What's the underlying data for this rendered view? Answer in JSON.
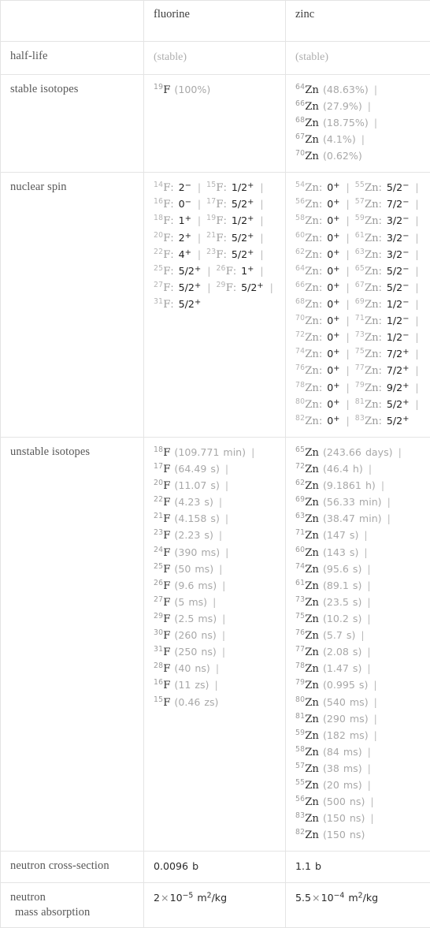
{
  "table": {
    "columns": [
      "",
      "fluorine",
      "zinc"
    ],
    "rows": [
      {
        "label": "half-life",
        "fluorine": "(stable)",
        "zinc": "(stable)"
      },
      {
        "label": "stable isotopes",
        "fluorine_items": [
          {
            "mass": "19",
            "element": "F",
            "value": "(100%)"
          }
        ],
        "zinc_items": [
          {
            "mass": "64",
            "element": "Zn",
            "value": "(48.63%)"
          },
          {
            "mass": "66",
            "element": "Zn",
            "value": "(27.9%)"
          },
          {
            "mass": "68",
            "element": "Zn",
            "value": "(18.75%)"
          },
          {
            "mass": "67",
            "element": "Zn",
            "value": "(4.1%)"
          },
          {
            "mass": "70",
            "element": "Zn",
            "value": "(0.62%)"
          }
        ]
      },
      {
        "label": "nuclear spin",
        "fluorine_items": [
          {
            "mass": "14",
            "element": "F",
            "spin": "2",
            "sign": "-"
          },
          {
            "mass": "15",
            "element": "F",
            "spin": "1/2",
            "sign": "+"
          },
          {
            "mass": "16",
            "element": "F",
            "spin": "0",
            "sign": "-"
          },
          {
            "mass": "17",
            "element": "F",
            "spin": "5/2",
            "sign": "+"
          },
          {
            "mass": "18",
            "element": "F",
            "spin": "1",
            "sign": "+"
          },
          {
            "mass": "19",
            "element": "F",
            "spin": "1/2",
            "sign": "+"
          },
          {
            "mass": "20",
            "element": "F",
            "spin": "2",
            "sign": "+"
          },
          {
            "mass": "21",
            "element": "F",
            "spin": "5/2",
            "sign": "+"
          },
          {
            "mass": "22",
            "element": "F",
            "spin": "4",
            "sign": "+"
          },
          {
            "mass": "23",
            "element": "F",
            "spin": "5/2",
            "sign": "+"
          },
          {
            "mass": "25",
            "element": "F",
            "spin": "5/2",
            "sign": "+"
          },
          {
            "mass": "26",
            "element": "F",
            "spin": "1",
            "sign": "+"
          },
          {
            "mass": "27",
            "element": "F",
            "spin": "5/2",
            "sign": "+"
          },
          {
            "mass": "29",
            "element": "F",
            "spin": "5/2",
            "sign": "+"
          },
          {
            "mass": "31",
            "element": "F",
            "spin": "5/2",
            "sign": "+"
          }
        ],
        "zinc_items": [
          {
            "mass": "54",
            "element": "Zn",
            "spin": "0",
            "sign": "+"
          },
          {
            "mass": "55",
            "element": "Zn",
            "spin": "5/2",
            "sign": "-"
          },
          {
            "mass": "56",
            "element": "Zn",
            "spin": "0",
            "sign": "+"
          },
          {
            "mass": "57",
            "element": "Zn",
            "spin": "7/2",
            "sign": "-"
          },
          {
            "mass": "58",
            "element": "Zn",
            "spin": "0",
            "sign": "+"
          },
          {
            "mass": "59",
            "element": "Zn",
            "spin": "3/2",
            "sign": "-"
          },
          {
            "mass": "60",
            "element": "Zn",
            "spin": "0",
            "sign": "+"
          },
          {
            "mass": "61",
            "element": "Zn",
            "spin": "3/2",
            "sign": "-"
          },
          {
            "mass": "62",
            "element": "Zn",
            "spin": "0",
            "sign": "+"
          },
          {
            "mass": "63",
            "element": "Zn",
            "spin": "3/2",
            "sign": "-"
          },
          {
            "mass": "64",
            "element": "Zn",
            "spin": "0",
            "sign": "+"
          },
          {
            "mass": "65",
            "element": "Zn",
            "spin": "5/2",
            "sign": "-"
          },
          {
            "mass": "66",
            "element": "Zn",
            "spin": "0",
            "sign": "+"
          },
          {
            "mass": "67",
            "element": "Zn",
            "spin": "5/2",
            "sign": "-"
          },
          {
            "mass": "68",
            "element": "Zn",
            "spin": "0",
            "sign": "+"
          },
          {
            "mass": "69",
            "element": "Zn",
            "spin": "1/2",
            "sign": "-"
          },
          {
            "mass": "70",
            "element": "Zn",
            "spin": "0",
            "sign": "+"
          },
          {
            "mass": "71",
            "element": "Zn",
            "spin": "1/2",
            "sign": "-"
          },
          {
            "mass": "72",
            "element": "Zn",
            "spin": "0",
            "sign": "+"
          },
          {
            "mass": "73",
            "element": "Zn",
            "spin": "1/2",
            "sign": "-"
          },
          {
            "mass": "74",
            "element": "Zn",
            "spin": "0",
            "sign": "+"
          },
          {
            "mass": "75",
            "element": "Zn",
            "spin": "7/2",
            "sign": "+"
          },
          {
            "mass": "76",
            "element": "Zn",
            "spin": "0",
            "sign": "+"
          },
          {
            "mass": "77",
            "element": "Zn",
            "spin": "7/2",
            "sign": "+"
          },
          {
            "mass": "78",
            "element": "Zn",
            "spin": "0",
            "sign": "+"
          },
          {
            "mass": "79",
            "element": "Zn",
            "spin": "9/2",
            "sign": "+"
          },
          {
            "mass": "80",
            "element": "Zn",
            "spin": "0",
            "sign": "+"
          },
          {
            "mass": "81",
            "element": "Zn",
            "spin": "5/2",
            "sign": "+"
          },
          {
            "mass": "82",
            "element": "Zn",
            "spin": "0",
            "sign": "+"
          },
          {
            "mass": "83",
            "element": "Zn",
            "spin": "5/2",
            "sign": "+"
          }
        ]
      },
      {
        "label": "unstable isotopes",
        "fluorine_items": [
          {
            "mass": "18",
            "element": "F",
            "value": "(109.771 min)"
          },
          {
            "mass": "17",
            "element": "F",
            "value": "(64.49 s)"
          },
          {
            "mass": "20",
            "element": "F",
            "value": "(11.07 s)"
          },
          {
            "mass": "22",
            "element": "F",
            "value": "(4.23 s)"
          },
          {
            "mass": "21",
            "element": "F",
            "value": "(4.158 s)"
          },
          {
            "mass": "23",
            "element": "F",
            "value": "(2.23 s)"
          },
          {
            "mass": "24",
            "element": "F",
            "value": "(390 ms)"
          },
          {
            "mass": "25",
            "element": "F",
            "value": "(50 ms)"
          },
          {
            "mass": "26",
            "element": "F",
            "value": "(9.6 ms)"
          },
          {
            "mass": "27",
            "element": "F",
            "value": "(5 ms)"
          },
          {
            "mass": "29",
            "element": "F",
            "value": "(2.5 ms)"
          },
          {
            "mass": "30",
            "element": "F",
            "value": "(260 ns)"
          },
          {
            "mass": "31",
            "element": "F",
            "value": "(250 ns)"
          },
          {
            "mass": "28",
            "element": "F",
            "value": "(40 ns)"
          },
          {
            "mass": "16",
            "element": "F",
            "value": "(11 zs)"
          },
          {
            "mass": "15",
            "element": "F",
            "value": "(0.46 zs)"
          }
        ],
        "zinc_items": [
          {
            "mass": "65",
            "element": "Zn",
            "value": "(243.66 days)"
          },
          {
            "mass": "72",
            "element": "Zn",
            "value": "(46.4 h)"
          },
          {
            "mass": "62",
            "element": "Zn",
            "value": "(9.1861 h)"
          },
          {
            "mass": "69",
            "element": "Zn",
            "value": "(56.33 min)"
          },
          {
            "mass": "63",
            "element": "Zn",
            "value": "(38.47 min)"
          },
          {
            "mass": "71",
            "element": "Zn",
            "value": "(147 s)"
          },
          {
            "mass": "60",
            "element": "Zn",
            "value": "(143 s)"
          },
          {
            "mass": "74",
            "element": "Zn",
            "value": "(95.6 s)"
          },
          {
            "mass": "61",
            "element": "Zn",
            "value": "(89.1 s)"
          },
          {
            "mass": "73",
            "element": "Zn",
            "value": "(23.5 s)"
          },
          {
            "mass": "75",
            "element": "Zn",
            "value": "(10.2 s)"
          },
          {
            "mass": "76",
            "element": "Zn",
            "value": "(5.7 s)"
          },
          {
            "mass": "77",
            "element": "Zn",
            "value": "(2.08 s)"
          },
          {
            "mass": "78",
            "element": "Zn",
            "value": "(1.47 s)"
          },
          {
            "mass": "79",
            "element": "Zn",
            "value": "(0.995 s)"
          },
          {
            "mass": "80",
            "element": "Zn",
            "value": "(540 ms)"
          },
          {
            "mass": "81",
            "element": "Zn",
            "value": "(290 ms)"
          },
          {
            "mass": "59",
            "element": "Zn",
            "value": "(182 ms)"
          },
          {
            "mass": "58",
            "element": "Zn",
            "value": "(84 ms)"
          },
          {
            "mass": "57",
            "element": "Zn",
            "value": "(38 ms)"
          },
          {
            "mass": "55",
            "element": "Zn",
            "value": "(20 ms)"
          },
          {
            "mass": "56",
            "element": "Zn",
            "value": "(500 ns)"
          },
          {
            "mass": "83",
            "element": "Zn",
            "value": "(150 ns)"
          },
          {
            "mass": "82",
            "element": "Zn",
            "value": "(150 ns)"
          }
        ]
      },
      {
        "label": "neutron cross-section",
        "fluorine": "0.0096 b",
        "zinc": "1.1 b"
      },
      {
        "label": "neutron mass absorption",
        "fluorine_sci": {
          "mantissa": "2",
          "exponent": "-5",
          "unit_base": "m",
          "unit_sup": "2",
          "unit_tail": "/kg"
        },
        "zinc_sci": {
          "mantissa": "5.5",
          "exponent": "-4",
          "unit_base": "m",
          "unit_sup": "2",
          "unit_tail": "/kg"
        }
      }
    ]
  },
  "separator": "|"
}
